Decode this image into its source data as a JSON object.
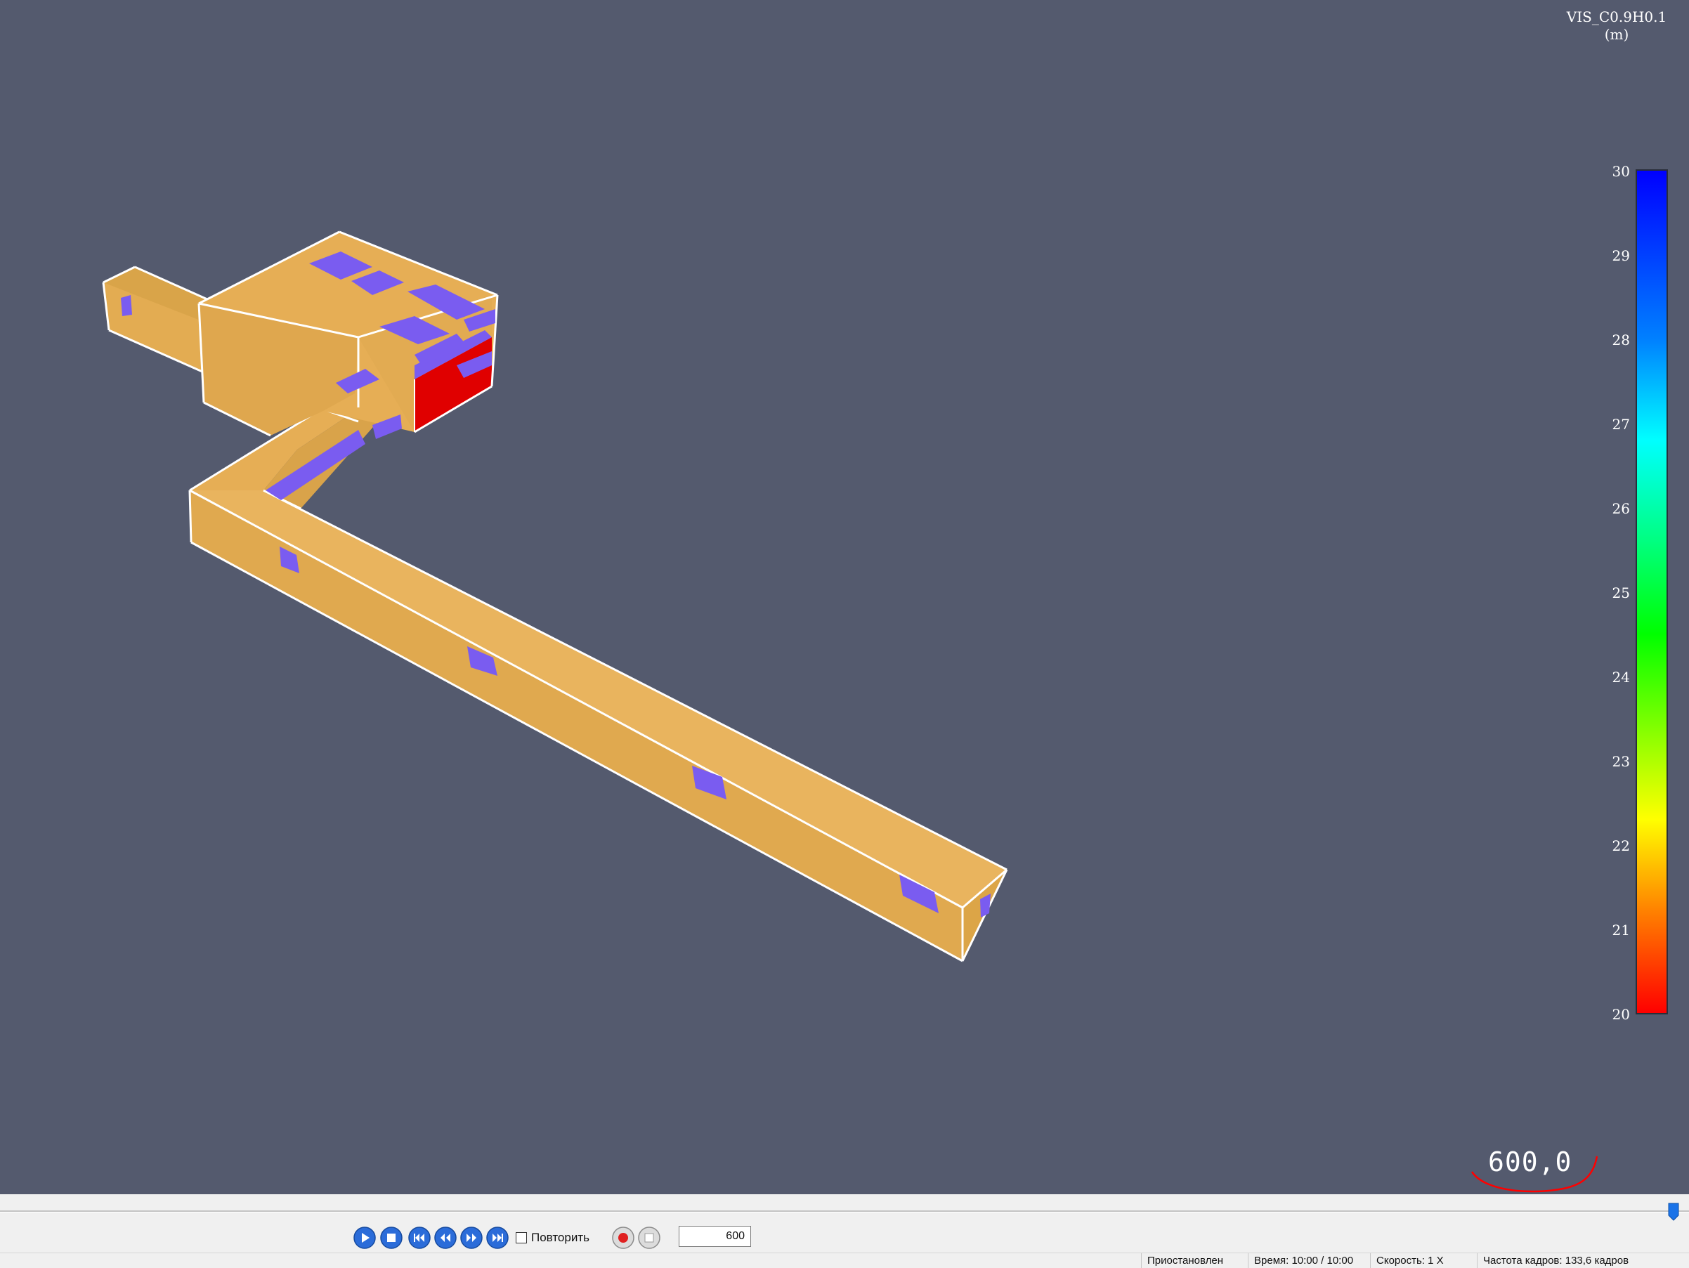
{
  "quantity": {
    "name": "VIS_C0.9H0.1",
    "unit": "(m)"
  },
  "colorbar": {
    "ticks": [
      "30",
      "29",
      "28",
      "27",
      "26",
      "25",
      "24",
      "23",
      "22",
      "21",
      "20"
    ],
    "colors": [
      "#0000ff",
      "#0080ff",
      "#00ffff",
      "#00ff00",
      "#ffff00",
      "#ff8000",
      "#ff0000"
    ]
  },
  "viewer": {
    "time_display": "600,0",
    "background": "#545a6e",
    "building_color": "#e6ac54",
    "cell_color": "#7a5cf0",
    "hot_cell_color": "#e00000",
    "timeline_progress": 1.0
  },
  "controls": {
    "play_icon": "play-icon",
    "stop_icon": "stop-icon",
    "first_icon": "skip-first-icon",
    "prev_icon": "step-back-icon",
    "next_icon": "step-forward-icon",
    "last_icon": "skip-last-icon",
    "repeat_label": "Повторить",
    "repeat_checked": false,
    "record_icon": "record-icon",
    "stop_record_icon": "record-stop-icon",
    "frame_value": "600"
  },
  "status": {
    "state": "Приостановлен",
    "time": "Время: 10:00 / 10:00",
    "speed": "Скорость: 1 X",
    "fps": "Частота кадров: 133,6 кадров"
  }
}
